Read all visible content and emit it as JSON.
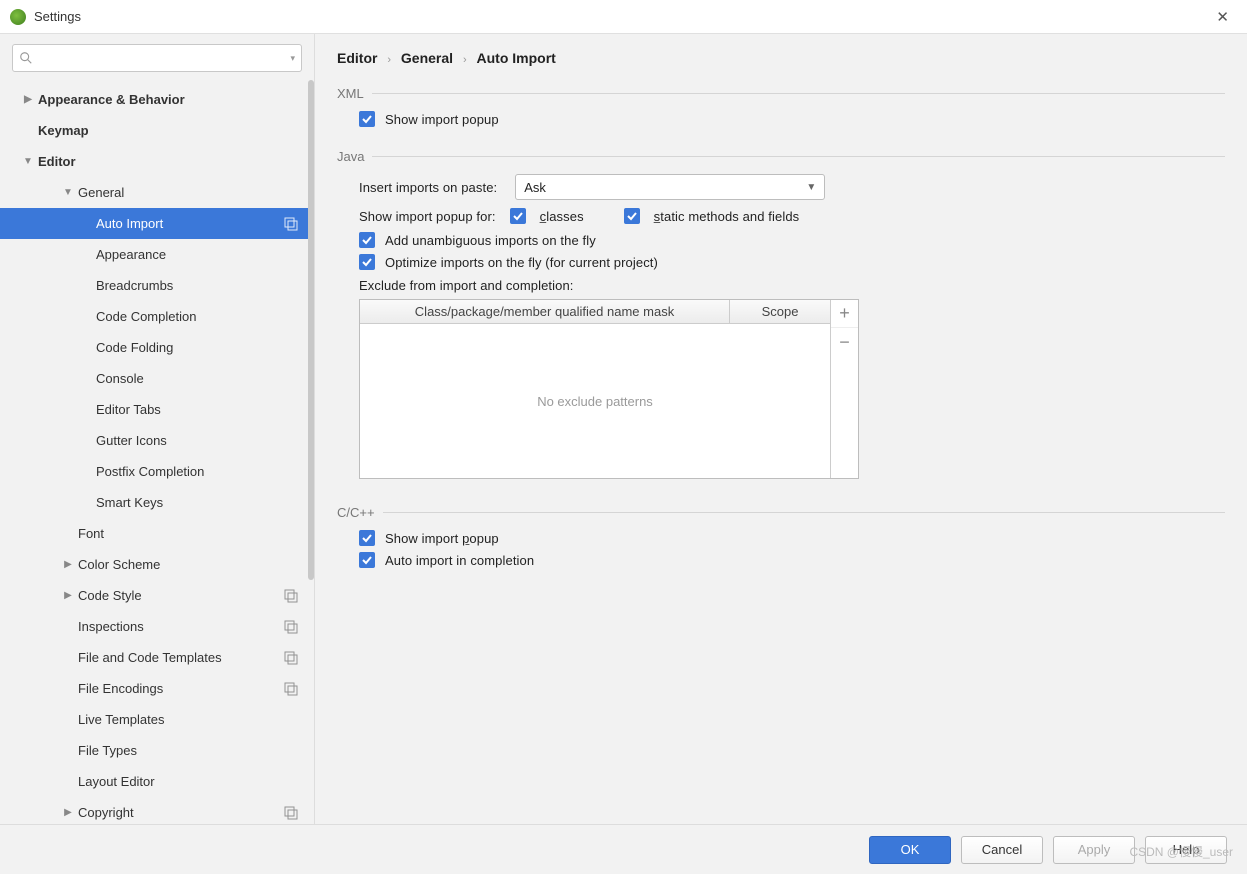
{
  "window": {
    "title": "Settings"
  },
  "search": {
    "placeholder": ""
  },
  "breadcrumbs": [
    "Editor",
    "General",
    "Auto Import"
  ],
  "tree": [
    {
      "label": "Appearance & Behavior",
      "depth": 0,
      "arrow": "right",
      "bold": true
    },
    {
      "label": "Keymap",
      "depth": 0,
      "arrow": "",
      "bold": true
    },
    {
      "label": "Editor",
      "depth": 0,
      "arrow": "down",
      "bold": true
    },
    {
      "label": "General",
      "depth": 1,
      "arrow": "down"
    },
    {
      "label": "Auto Import",
      "depth": 2,
      "selected": true,
      "badge": true
    },
    {
      "label": "Appearance",
      "depth": 2
    },
    {
      "label": "Breadcrumbs",
      "depth": 2
    },
    {
      "label": "Code Completion",
      "depth": 2
    },
    {
      "label": "Code Folding",
      "depth": 2
    },
    {
      "label": "Console",
      "depth": 2
    },
    {
      "label": "Editor Tabs",
      "depth": 2
    },
    {
      "label": "Gutter Icons",
      "depth": 2
    },
    {
      "label": "Postfix Completion",
      "depth": 2
    },
    {
      "label": "Smart Keys",
      "depth": 2
    },
    {
      "label": "Font",
      "depth": 1
    },
    {
      "label": "Color Scheme",
      "depth": 1,
      "arrow": "right"
    },
    {
      "label": "Code Style",
      "depth": 1,
      "arrow": "right",
      "badge": true
    },
    {
      "label": "Inspections",
      "depth": 1,
      "badge": true
    },
    {
      "label": "File and Code Templates",
      "depth": 1,
      "badge": true
    },
    {
      "label": "File Encodings",
      "depth": 1,
      "badge": true
    },
    {
      "label": "Live Templates",
      "depth": 1
    },
    {
      "label": "File Types",
      "depth": 1
    },
    {
      "label": "Layout Editor",
      "depth": 1
    },
    {
      "label": "Copyright",
      "depth": 1,
      "arrow": "right",
      "badge": true
    }
  ],
  "xml": {
    "title": "XML",
    "show_import_popup": "Show import popup"
  },
  "java": {
    "title": "Java",
    "insert_label": "Insert imports on paste:",
    "insert_value": "Ask",
    "popup_for_label": "Show import popup for:",
    "classes": "classes",
    "static": "static methods and fields",
    "unambiguous": "Add unambiguous imports on the fly",
    "optimize": "Optimize imports on the fly (for current project)",
    "exclude_label": "Exclude from import and completion:",
    "col1": "Class/package/member qualified name mask",
    "col2": "Scope",
    "empty": "No exclude patterns"
  },
  "cpp": {
    "title": "C/C++",
    "show_popup": "Show import popup",
    "auto_import": "Auto import in completion"
  },
  "buttons": {
    "ok": "OK",
    "cancel": "Cancel",
    "apply": "Apply",
    "help": "Help"
  },
  "watermark": "CSDN @慢慢_user"
}
